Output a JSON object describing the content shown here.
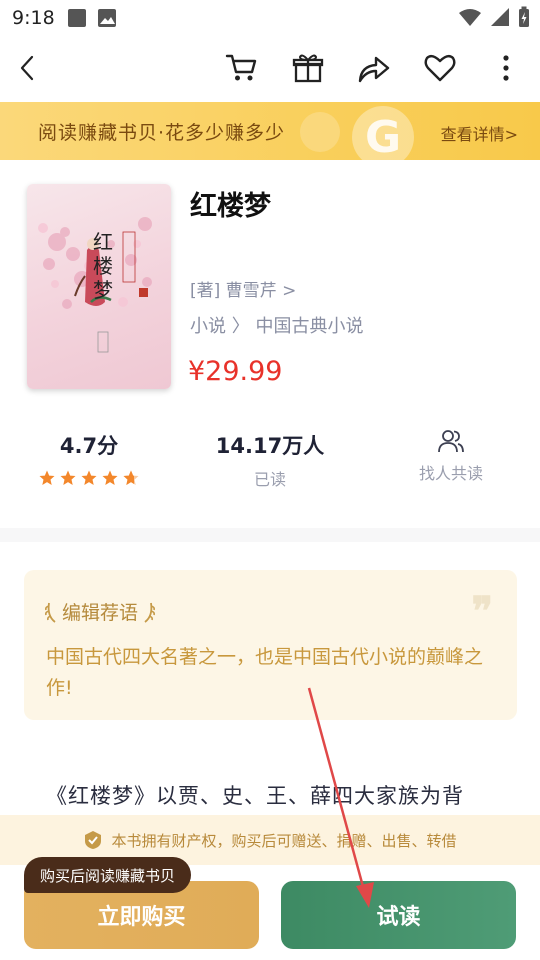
{
  "status_bar": {
    "time": "9:18",
    "icons": [
      "square-notification-icon",
      "image-notification-icon",
      "wifi-icon",
      "signal-icon",
      "battery-charging-icon"
    ]
  },
  "nav": {
    "icons": [
      "back-icon",
      "cart-icon",
      "gift-icon",
      "share-icon",
      "heart-icon",
      "more-icon"
    ]
  },
  "banner": {
    "text": "阅读赚藏书贝·花多少赚多少",
    "link": "查看详情>",
    "badge_letter": "G"
  },
  "book": {
    "cover_title_chars": "红楼梦",
    "title": "红楼梦",
    "author": "[著] 曹雪芹 >",
    "category": "小说 〉 中国古典小说",
    "price": "¥29.99"
  },
  "stats": {
    "rating_value": "4.7分",
    "rating_stars": 4.7,
    "readers_value": "14.17万人",
    "readers_label": "已读",
    "co_read_label": "找人共读"
  },
  "recommendation": {
    "title": "编辑荐语",
    "quote_mark": "❞",
    "text": "中国古代四大名著之一，也是中国古代小说的巅峰之作!"
  },
  "intro": {
    "text": "《红楼梦》以贾、史、王、薛四大家族为背"
  },
  "rights": {
    "text": "本书拥有财产权，购买后可赠送、捐赠、出售、转借"
  },
  "actions": {
    "tooltip": "购买后阅读赚藏书贝",
    "buy_label": "立即购买",
    "try_label": "试读"
  },
  "colors": {
    "price": "#e8322a",
    "buy_button": "#e0ac58",
    "try_button": "#4a9670",
    "annotation_arrow": "#e04848"
  }
}
